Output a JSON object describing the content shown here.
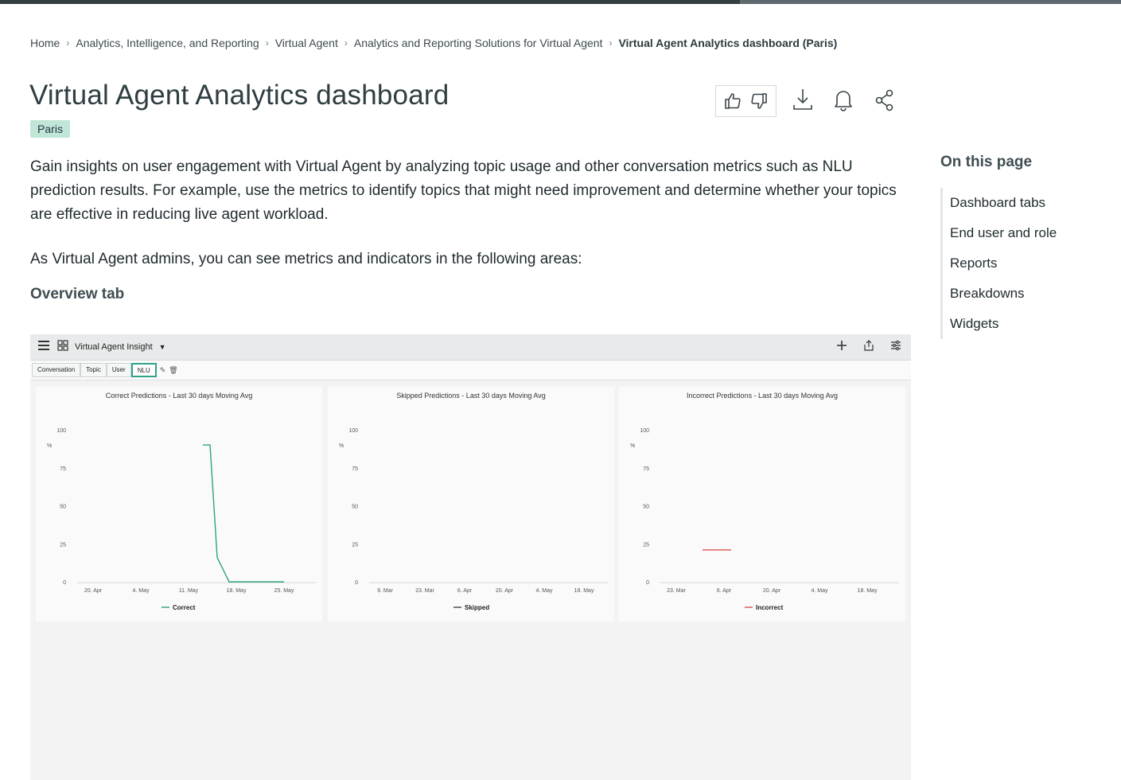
{
  "progress": {
    "value_fraction": 0.66
  },
  "breadcrumb": [
    {
      "label": "Home"
    },
    {
      "label": "Analytics, Intelligence, and Reporting"
    },
    {
      "label": "Virtual Agent"
    },
    {
      "label": "Analytics and Reporting Solutions for Virtual Agent"
    },
    {
      "label": "Virtual Agent Analytics dashboard (Paris)"
    }
  ],
  "page": {
    "title": "Virtual Agent Analytics dashboard",
    "release": "Paris",
    "intro": "Gain insights on user engagement with Virtual Agent by analyzing topic usage and other conversation metrics such as NLU prediction results. For example, use the metrics to identify topics that might need improvement and determine whether your topics are effective in reducing live agent workload.",
    "admins_text": "As Virtual Agent admins, you can see metrics and indicators in the following areas:",
    "section_heading": "Overview tab"
  },
  "toc": {
    "title": "On this page",
    "items": [
      "Dashboard tabs",
      "End user and role",
      "Reports",
      "Breakdowns",
      "Widgets"
    ]
  },
  "icons": {
    "like": "thumbs-up-icon",
    "dislike": "thumbs-down-icon",
    "download": "download-icon",
    "subscribe": "bell-icon",
    "share": "share-icon"
  },
  "screenshot": {
    "dashboard_title": "Virtual Agent Insight",
    "tabs": [
      "Conversation",
      "Topic",
      "User",
      "NLU"
    ],
    "active_tab": "NLU",
    "colors": {
      "correct": "#2ea37a",
      "incorrect": "#d9534f",
      "skipped": "#444444"
    }
  },
  "chart_data": [
    {
      "type": "line",
      "title": "Correct Predictions - Last 30 days Moving Avg",
      "ylabel": "%",
      "ylim": [
        0,
        100
      ],
      "yticks": [
        0,
        25,
        50,
        75,
        100
      ],
      "xticks": [
        "20. Apr",
        "4. May",
        "11. May",
        "18. May",
        "25. May"
      ],
      "series": [
        {
          "name": "Correct",
          "points": [
            [
              2.3,
              90
            ],
            [
              2.45,
              90
            ],
            [
              2.6,
              16
            ],
            [
              2.85,
              0
            ],
            [
              4.0,
              0
            ]
          ]
        }
      ]
    },
    {
      "type": "line",
      "title": "Skipped Predictions - Last 30 days Moving Avg",
      "ylabel": "%",
      "ylim": [
        0,
        100
      ],
      "yticks": [
        0,
        25,
        50,
        75,
        100
      ],
      "xticks": [
        "9. Mar",
        "23. Mar",
        "6. Apr",
        "20. Apr",
        "4. May",
        "18. May"
      ],
      "series": [
        {
          "name": "Skipped",
          "points": []
        }
      ]
    },
    {
      "type": "line",
      "title": "Incorrect Predictions - Last 30 days Moving Avg",
      "ylabel": "%",
      "ylim": [
        0,
        100
      ],
      "yticks": [
        0,
        25,
        50,
        75,
        100
      ],
      "xticks": [
        "23. Mar",
        "6. Apr",
        "20. Apr",
        "4. May",
        "18. May"
      ],
      "series": [
        {
          "name": "Incorrect",
          "points": [
            [
              0.55,
              21
            ],
            [
              1.15,
              21
            ]
          ]
        }
      ]
    }
  ]
}
